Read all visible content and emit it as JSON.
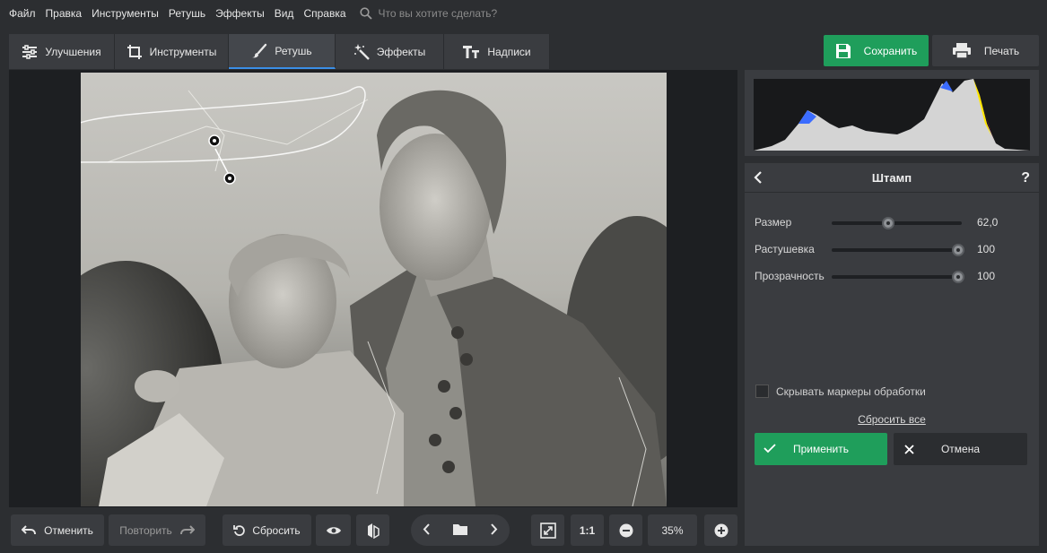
{
  "menu": {
    "items": [
      "Файл",
      "Правка",
      "Инструменты",
      "Ретушь",
      "Эффекты",
      "Вид",
      "Справка"
    ],
    "search_placeholder": "Что вы хотите сделать?"
  },
  "tabs": [
    {
      "label": "Улучшения",
      "icon": "sliders-icon"
    },
    {
      "label": "Инструменты",
      "icon": "crop-icon"
    },
    {
      "label": "Ретушь",
      "icon": "brush-icon",
      "active": true
    },
    {
      "label": "Эффекты",
      "icon": "magic-wand-icon"
    },
    {
      "label": "Надписи",
      "icon": "text-icon"
    }
  ],
  "toolbar": {
    "save_label": "Сохранить",
    "print_label": "Печать"
  },
  "stamp_panel": {
    "title": "Штамп",
    "help": "?",
    "sliders": [
      {
        "label": "Размер",
        "value": "62,0",
        "level": 0.43
      },
      {
        "label": "Растушевка",
        "value": "100",
        "level": 1.0
      },
      {
        "label": "Прозрачность",
        "value": "100",
        "level": 1.0
      }
    ],
    "hide_markers_label": "Скрывать маркеры обработки",
    "hide_markers_checked": false,
    "reset_all": "Сбросить все",
    "apply_label": "Применить",
    "cancel_label": "Отмена"
  },
  "bottom": {
    "undo_label": "Отменить",
    "redo_label": "Повторить",
    "reset_label": "Сбросить",
    "one_to_one": "1:1",
    "zoom": "35%"
  },
  "colors": {
    "accent": "#1f9e5b",
    "active_tab": "#3a8ee6",
    "panel": "#3a3c40",
    "background": "#2c2e31"
  }
}
